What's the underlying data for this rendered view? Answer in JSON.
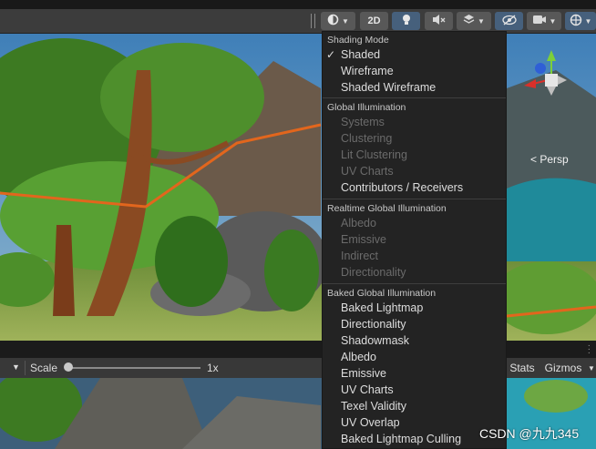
{
  "toolbar": {
    "draw_mode_icon": "circle-shading-icon",
    "btn_2d_label": "2D",
    "lighting_icon": "lightbulb-icon",
    "audio_icon": "audio-mute-icon",
    "effects_icon": "layers-icon",
    "visibility_icon": "eye-slash-icon",
    "camera_icon": "camera-icon",
    "gizmo_icon": "globe-icon",
    "accent_color": "#46607c"
  },
  "viewport": {
    "projection_label": "< Persp"
  },
  "shading_menu": {
    "sections": [
      {
        "header": "Shading Mode",
        "items": [
          {
            "label": "Shaded",
            "checked": true,
            "enabled": true
          },
          {
            "label": "Wireframe",
            "checked": false,
            "enabled": true
          },
          {
            "label": "Shaded Wireframe",
            "checked": false,
            "enabled": true
          }
        ]
      },
      {
        "header": "Global Illumination",
        "items": [
          {
            "label": "Systems",
            "enabled": false
          },
          {
            "label": "Clustering",
            "enabled": false
          },
          {
            "label": "Lit Clustering",
            "enabled": false
          },
          {
            "label": "UV Charts",
            "enabled": false
          },
          {
            "label": "Contributors / Receivers",
            "enabled": true
          }
        ]
      },
      {
        "header": "Realtime Global Illumination",
        "items": [
          {
            "label": "Albedo",
            "enabled": false
          },
          {
            "label": "Emissive",
            "enabled": false
          },
          {
            "label": "Indirect",
            "enabled": false
          },
          {
            "label": "Directionality",
            "enabled": false
          }
        ]
      },
      {
        "header": "Baked Global Illumination",
        "items": [
          {
            "label": "Baked Lightmap",
            "enabled": true
          },
          {
            "label": "Directionality",
            "enabled": true
          },
          {
            "label": "Shadowmask",
            "enabled": true
          },
          {
            "label": "Albedo",
            "enabled": true
          },
          {
            "label": "Emissive",
            "enabled": true
          },
          {
            "label": "UV Charts",
            "enabled": true
          },
          {
            "label": "Texel Validity",
            "enabled": true
          },
          {
            "label": "UV Overlap",
            "enabled": true
          },
          {
            "label": "Baked Lightmap Culling",
            "enabled": true
          }
        ]
      }
    ],
    "check_mark": "✓"
  },
  "game_toolbar": {
    "scale_label": "Scale",
    "scale_value": "1x",
    "stats_label": "Stats",
    "gizmos_label": "Gizmos"
  },
  "watermark": "CSDN @九九345"
}
